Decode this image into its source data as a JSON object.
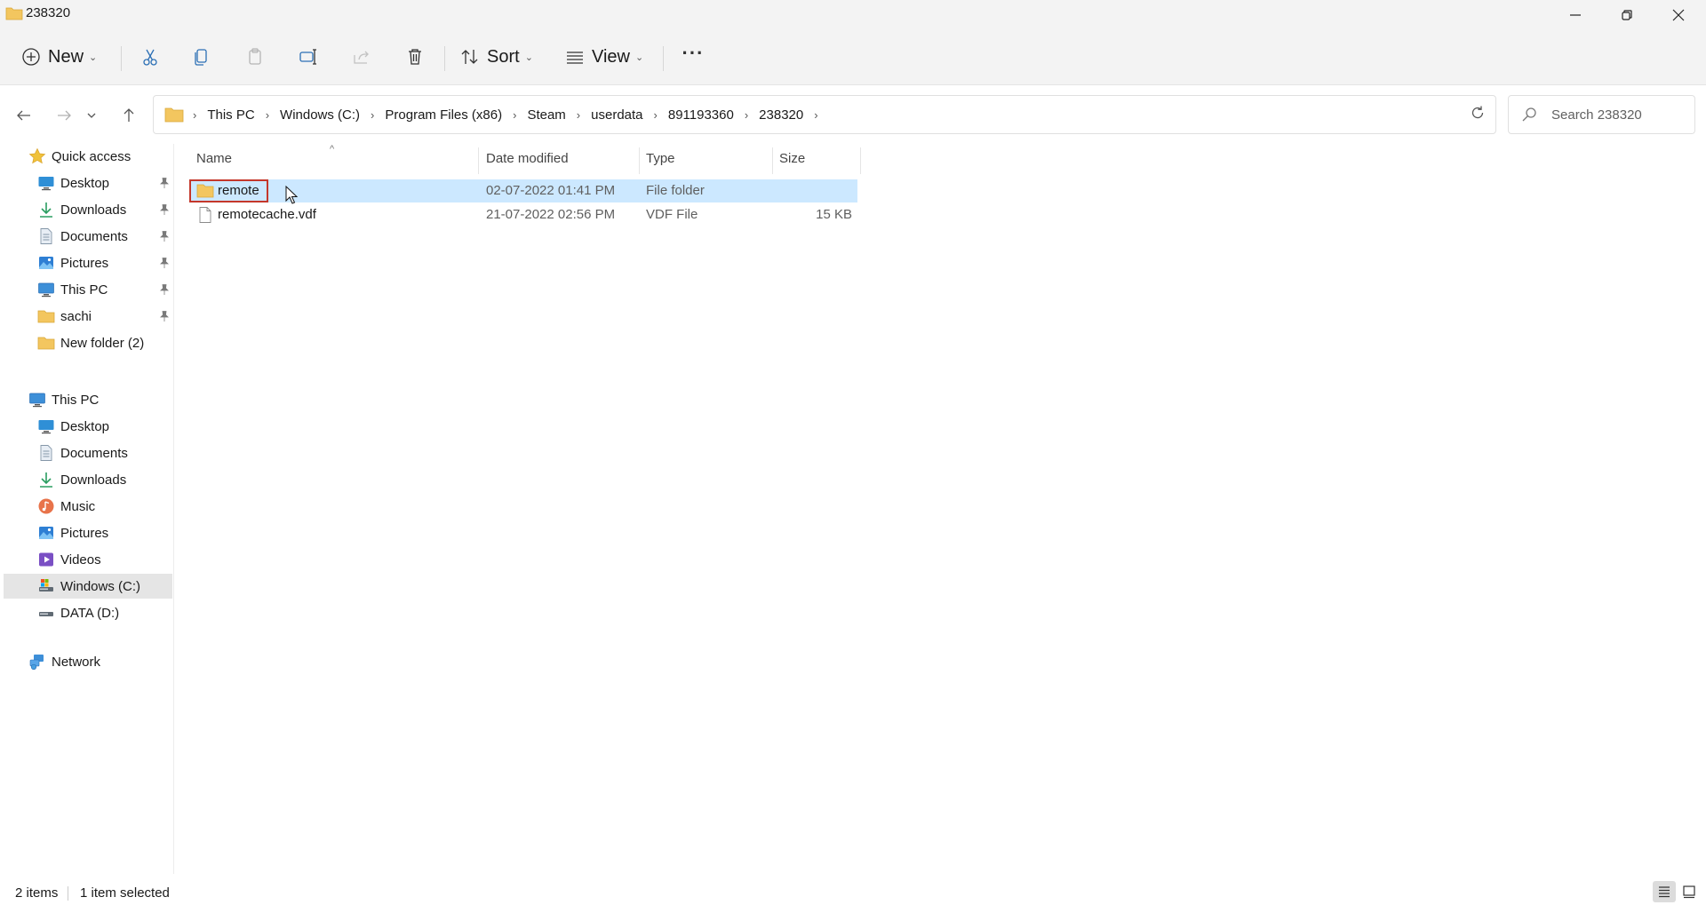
{
  "window": {
    "title": "238320",
    "minimize": "minimize",
    "maximize": "restore",
    "close": "close"
  },
  "toolbar": {
    "new_label": "New",
    "sort_label": "Sort",
    "view_label": "View",
    "more_label": "···"
  },
  "address": {
    "crumbs": [
      "This PC",
      "Windows (C:)",
      "Program Files (x86)",
      "Steam",
      "userdata",
      "891193360",
      "238320"
    ]
  },
  "search": {
    "placeholder": "Search 238320"
  },
  "sidebar": {
    "quick_access": {
      "label": "Quick access",
      "items": [
        {
          "label": "Desktop",
          "pinned": true
        },
        {
          "label": "Downloads",
          "pinned": true
        },
        {
          "label": "Documents",
          "pinned": true
        },
        {
          "label": "Pictures",
          "pinned": true
        },
        {
          "label": "This PC",
          "pinned": true
        },
        {
          "label": "sachi",
          "pinned": true
        },
        {
          "label": "New folder (2)",
          "pinned": false
        }
      ]
    },
    "this_pc": {
      "label": "This PC",
      "items": [
        {
          "label": "Desktop"
        },
        {
          "label": "Documents"
        },
        {
          "label": "Downloads"
        },
        {
          "label": "Music"
        },
        {
          "label": "Pictures"
        },
        {
          "label": "Videos"
        },
        {
          "label": "Windows (C:)"
        },
        {
          "label": "DATA (D:)"
        }
      ]
    },
    "network": {
      "label": "Network"
    }
  },
  "columns": {
    "name": "Name",
    "date": "Date modified",
    "type": "Type",
    "size": "Size"
  },
  "files": [
    {
      "name": "remote",
      "date": "02-07-2022 01:41 PM",
      "type": "File folder",
      "size": ""
    },
    {
      "name": "remotecache.vdf",
      "date": "21-07-2022 02:56 PM",
      "type": "VDF File",
      "size": "15 KB"
    }
  ],
  "status": {
    "count": "2 items",
    "selection": "1 item selected"
  },
  "colors": {
    "accent": "#0067c0",
    "selection": "#cce8ff",
    "highlight_box": "#c4372b",
    "folder": "#f3c65f"
  }
}
